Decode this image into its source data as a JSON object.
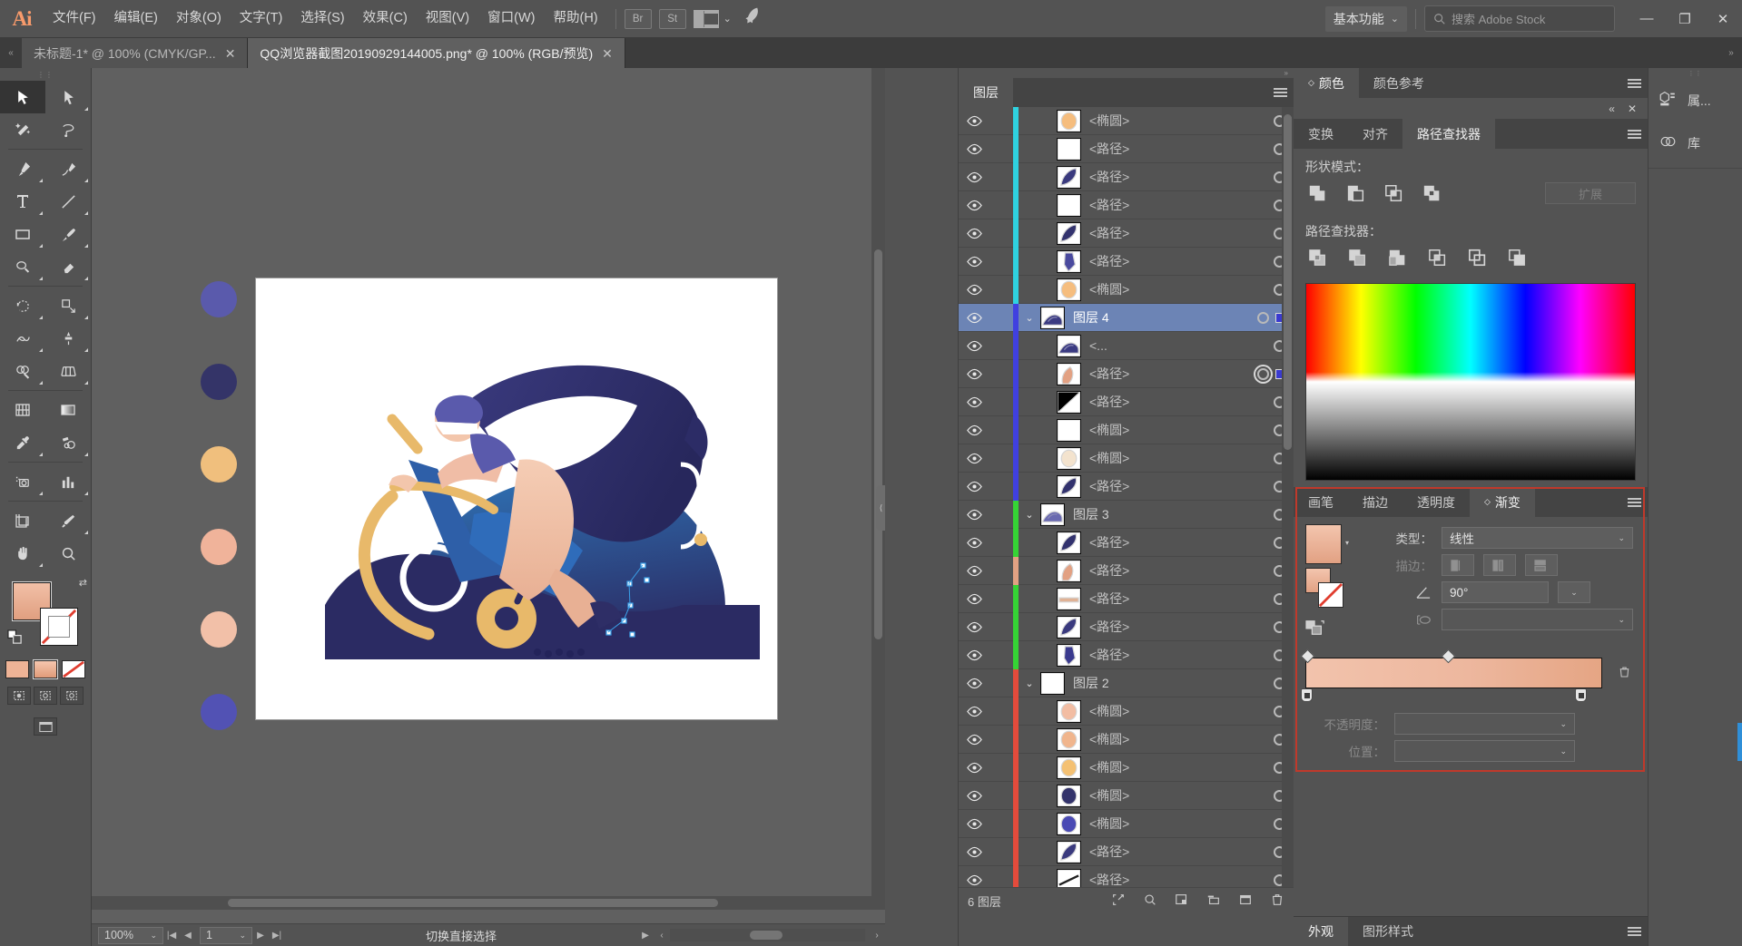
{
  "app": {
    "logo": "Ai",
    "title": "Adobe Illustrator"
  },
  "menubar": {
    "items": [
      {
        "label": "文件(F)"
      },
      {
        "label": "编辑(E)"
      },
      {
        "label": "对象(O)"
      },
      {
        "label": "文字(T)"
      },
      {
        "label": "选择(S)"
      },
      {
        "label": "效果(C)"
      },
      {
        "label": "视图(V)"
      },
      {
        "label": "窗口(W)"
      },
      {
        "label": "帮助(H)"
      }
    ],
    "bridge_label": "Br",
    "stock_label": "St",
    "arrange_icon": "arrange-documents-icon",
    "rocket_icon": "rocket-icon",
    "workspace": "基本功能",
    "workspace_chevron": "⌄",
    "search_placeholder": "搜索 Adobe Stock",
    "search_icon": "search-icon",
    "window_buttons": [
      {
        "name": "minimize-button",
        "glyph": "—"
      },
      {
        "name": "restore-button",
        "glyph": "❐"
      },
      {
        "name": "close-button",
        "glyph": "✕"
      }
    ]
  },
  "tabs": {
    "collapse_icon": "chevrons-left-icon",
    "items": [
      {
        "label": "未标题-1* @ 100% (CMYK/GP...",
        "active": false,
        "close": "✕"
      },
      {
        "label": "QQ浏览器截图20190929144005.png* @ 100% (RGB/预览)",
        "active": true,
        "close": "✕"
      }
    ],
    "expand_icon": "chevrons-right-icon"
  },
  "toolbar": {
    "grip": "⋮⋮",
    "tools": [
      {
        "name": "selection-tool",
        "selected": true,
        "corner": false
      },
      {
        "name": "direct-selection-tool",
        "selected": false,
        "corner": true
      },
      {
        "name": "magic-wand-tool",
        "selected": false,
        "corner": false
      },
      {
        "name": "lasso-tool",
        "selected": false,
        "corner": false
      },
      {
        "name": "pen-tool",
        "selected": false,
        "corner": true
      },
      {
        "name": "curvature-tool",
        "selected": false,
        "corner": true
      },
      {
        "name": "type-tool",
        "selected": false,
        "corner": true
      },
      {
        "name": "line-segment-tool",
        "selected": false,
        "corner": true
      },
      {
        "name": "rectangle-tool",
        "selected": false,
        "corner": true
      },
      {
        "name": "paintbrush-tool",
        "selected": false,
        "corner": true
      },
      {
        "name": "shaper-tool",
        "selected": false,
        "corner": true
      },
      {
        "name": "eraser-tool",
        "selected": false,
        "corner": true
      },
      {
        "name": "rotate-tool",
        "selected": false,
        "corner": true
      },
      {
        "name": "scale-tool",
        "selected": false,
        "corner": true
      },
      {
        "name": "width-tool",
        "selected": false,
        "corner": true
      },
      {
        "name": "free-transform-tool",
        "selected": false,
        "corner": true
      },
      {
        "name": "shape-builder-tool",
        "selected": false,
        "corner": true
      },
      {
        "name": "perspective-grid-tool",
        "selected": false,
        "corner": true
      },
      {
        "name": "mesh-tool",
        "selected": false,
        "corner": false
      },
      {
        "name": "gradient-tool",
        "selected": false,
        "corner": false
      },
      {
        "name": "eyedropper-tool",
        "selected": false,
        "corner": true
      },
      {
        "name": "blend-tool",
        "selected": false,
        "corner": true
      },
      {
        "name": "symbol-sprayer-tool",
        "selected": false,
        "corner": true
      },
      {
        "name": "column-graph-tool",
        "selected": false,
        "corner": true
      },
      {
        "name": "artboard-tool",
        "selected": false,
        "corner": false
      },
      {
        "name": "slice-tool",
        "selected": false,
        "corner": true
      },
      {
        "name": "hand-tool",
        "selected": false,
        "corner": true
      },
      {
        "name": "zoom-tool",
        "selected": false,
        "corner": false
      }
    ],
    "fill_color": "#eeb396",
    "stroke_color": "#ffffff",
    "swap_icon": "swap-fill-stroke-icon",
    "default_icon": "default-fill-stroke-icon",
    "paint_modes": [
      {
        "name": "color-mode",
        "selected": false,
        "color": "#eeb396"
      },
      {
        "name": "gradient-mode",
        "selected": true,
        "color": "#eeb396"
      },
      {
        "name": "none-mode",
        "selected": false,
        "color": "none"
      }
    ],
    "screen_modes": [
      {
        "name": "normal-screen-mode",
        "selected": false
      },
      {
        "name": "full-screen-menubar-mode",
        "selected": false
      },
      {
        "name": "full-screen-mode",
        "selected": false
      }
    ],
    "draw_modes": [
      {
        "name": "draw-normal",
        "selected": true
      },
      {
        "name": "draw-behind",
        "selected": false
      }
    ]
  },
  "canvas": {
    "artboard_background": "#ffffff",
    "swatch_circles": [
      {
        "color": "#5a5aac"
      },
      {
        "color": "#343468"
      },
      {
        "color": "#f0bf7d"
      },
      {
        "color": "#f0b39a"
      },
      {
        "color": "#f0bda6"
      },
      {
        "color": "#5252b4"
      }
    ],
    "illustration_name": "cyclist-on-stationary-bike-illustration",
    "collapse_grip": "⟨"
  },
  "statusbar": {
    "zoom_level": "100%",
    "zoom_dropdown": "⌄",
    "nav_first": "|◀",
    "nav_prev": "◀",
    "page": "1",
    "page_dropdown": "⌄",
    "nav_next": "▶",
    "nav_last": "▶|",
    "status_text": "切换直接选择",
    "status_arrow": "▶",
    "scroll_left": "‹",
    "scroll_right": "›"
  },
  "layers_panel": {
    "tab_label": "图层",
    "menu_icon": "panel-menu-icon",
    "rows": [
      {
        "name": "<椭圆>",
        "type": "child",
        "color": "#2fd2e0",
        "thumb": "#f5bd7e",
        "thumb_kind": "ellipse",
        "eye": true,
        "selected": false,
        "target_double": false,
        "has_sel_square": false
      },
      {
        "name": "<路径>",
        "type": "child",
        "color": "#2fd2e0",
        "thumb": "#ffffff",
        "thumb_kind": "blank",
        "eye": true,
        "selected": false,
        "target_double": false,
        "has_sel_square": false
      },
      {
        "name": "<路径>",
        "type": "child",
        "color": "#2fd2e0",
        "thumb": "#3a3a7e",
        "thumb_kind": "leaf",
        "eye": true,
        "selected": false,
        "target_double": false,
        "has_sel_square": false
      },
      {
        "name": "<路径>",
        "type": "child",
        "color": "#2fd2e0",
        "thumb": "#ffffff",
        "thumb_kind": "blank",
        "eye": true,
        "selected": false,
        "target_double": false,
        "has_sel_square": false
      },
      {
        "name": "<路径>",
        "type": "child",
        "color": "#2fd2e0",
        "thumb": "#33336e",
        "thumb_kind": "leaf",
        "eye": true,
        "selected": false,
        "target_double": false,
        "has_sel_square": false
      },
      {
        "name": "<路径>",
        "type": "child",
        "color": "#2fd2e0",
        "thumb": "#4a4a9e",
        "thumb_kind": "shape",
        "eye": true,
        "selected": false,
        "target_double": false,
        "has_sel_square": false
      },
      {
        "name": "<椭圆>",
        "type": "child",
        "color": "#2fd2e0",
        "thumb": "#f5bd7e",
        "thumb_kind": "ellipse",
        "eye": true,
        "selected": false,
        "target_double": false,
        "has_sel_square": false
      },
      {
        "name": "图层 4",
        "type": "group",
        "color": "#4040e0",
        "thumb": "#3b3b82",
        "thumb_kind": "scene",
        "eye": true,
        "selected": true,
        "target_double": false,
        "has_sel_square": true
      },
      {
        "name": "<...",
        "type": "child",
        "color": "#4040e0",
        "thumb": "#3b3b82",
        "thumb_kind": "scene",
        "eye": true,
        "selected": false,
        "target_double": false,
        "has_sel_square": false
      },
      {
        "name": "<路径>",
        "type": "child",
        "color": "#4040e0",
        "thumb": "#e2a183",
        "thumb_kind": "skin",
        "eye": true,
        "selected": false,
        "target_double": true,
        "has_sel_square": true
      },
      {
        "name": "<路径>",
        "type": "child",
        "color": "#4040e0",
        "thumb": "#000000",
        "thumb_kind": "triangle",
        "eye": true,
        "selected": false,
        "target_double": false,
        "has_sel_square": false
      },
      {
        "name": "<椭圆>",
        "type": "child",
        "color": "#4040e0",
        "thumb": "#ffffff",
        "thumb_kind": "blank",
        "eye": true,
        "selected": false,
        "target_double": false,
        "has_sel_square": false
      },
      {
        "name": "<椭圆>",
        "type": "child",
        "color": "#4040e0",
        "thumb": "#f3e3ce",
        "thumb_kind": "ellipse",
        "eye": true,
        "selected": false,
        "target_double": false,
        "has_sel_square": false
      },
      {
        "name": "<路径>",
        "type": "child",
        "color": "#4040e0",
        "thumb": "#32326e",
        "thumb_kind": "leaf",
        "eye": true,
        "selected": false,
        "target_double": false,
        "has_sel_square": false
      },
      {
        "name": "图层 3",
        "type": "group",
        "color": "#35d435",
        "thumb": "#6a6ab0",
        "thumb_kind": "scene",
        "eye": true,
        "selected": false,
        "target_double": false,
        "has_sel_square": false
      },
      {
        "name": "<路径>",
        "type": "child",
        "color": "#35d435",
        "thumb": "#32326e",
        "thumb_kind": "leaf",
        "eye": true,
        "selected": false,
        "target_double": false,
        "has_sel_square": false
      },
      {
        "name": "<路径>",
        "type": "child",
        "color": "#e2a183",
        "thumb": "#e2a183",
        "thumb_kind": "skin",
        "eye": true,
        "selected": false,
        "target_double": false,
        "has_sel_square": false
      },
      {
        "name": "<路径>",
        "type": "child",
        "color": "#35d435",
        "thumb": "#e0b295",
        "thumb_kind": "bar",
        "eye": true,
        "selected": false,
        "target_double": false,
        "has_sel_square": false
      },
      {
        "name": "<路径>",
        "type": "child",
        "color": "#35d435",
        "thumb": "#3a3a7e",
        "thumb_kind": "leaf",
        "eye": true,
        "selected": false,
        "target_double": false,
        "has_sel_square": false
      },
      {
        "name": "<路径>",
        "type": "child",
        "color": "#35d435",
        "thumb": "#3a3a8e",
        "thumb_kind": "shape",
        "eye": true,
        "selected": false,
        "target_double": false,
        "has_sel_square": false
      },
      {
        "name": "图层 2",
        "type": "group",
        "color": "#e44b3c",
        "thumb": "#ffffff",
        "thumb_kind": "blank",
        "eye": true,
        "selected": false,
        "target_double": false,
        "has_sel_square": false
      },
      {
        "name": "<椭圆>",
        "type": "child",
        "color": "#e44b3c",
        "thumb": "#f2bda3",
        "thumb_kind": "ellipse",
        "eye": true,
        "selected": false,
        "target_double": false,
        "has_sel_square": false
      },
      {
        "name": "<椭圆>",
        "type": "child",
        "color": "#e44b3c",
        "thumb": "#f0b58d",
        "thumb_kind": "ellipse",
        "eye": true,
        "selected": false,
        "target_double": false,
        "has_sel_square": false
      },
      {
        "name": "<椭圆>",
        "type": "child",
        "color": "#e44b3c",
        "thumb": "#f4c173",
        "thumb_kind": "ellipse",
        "eye": true,
        "selected": false,
        "target_double": false,
        "has_sel_square": false
      },
      {
        "name": "<椭圆>",
        "type": "child",
        "color": "#e44b3c",
        "thumb": "#33336b",
        "thumb_kind": "ellipse",
        "eye": true,
        "selected": false,
        "target_double": false,
        "has_sel_square": false
      },
      {
        "name": "<椭圆>",
        "type": "child",
        "color": "#e44b3c",
        "thumb": "#4a4ab4",
        "thumb_kind": "ellipse",
        "eye": true,
        "selected": false,
        "target_double": false,
        "has_sel_square": false
      },
      {
        "name": "<路径>",
        "type": "child",
        "color": "#e44b3c",
        "thumb": "#3a3a7e",
        "thumb_kind": "leaf",
        "eye": true,
        "selected": false,
        "target_double": false,
        "has_sel_square": false
      },
      {
        "name": "<路径>",
        "type": "child",
        "color": "#e44b3c",
        "thumb": "#202020",
        "thumb_kind": "line",
        "eye": true,
        "selected": false,
        "target_double": false,
        "has_sel_square": false
      }
    ],
    "footer": {
      "count_text": "6 图层",
      "icons": [
        {
          "name": "locate-object-icon",
          "glyph": "⇱"
        },
        {
          "name": "search-layers-icon",
          "glyph": "⌕"
        },
        {
          "name": "make-clipping-mask-icon",
          "glyph": "▣"
        },
        {
          "name": "create-new-sublayer-icon",
          "glyph": "⧉"
        },
        {
          "name": "create-new-layer-icon",
          "glyph": "▤"
        },
        {
          "name": "delete-selection-icon",
          "glyph": "🗑"
        }
      ]
    }
  },
  "color_panel": {
    "tabs": [
      {
        "label": "颜色",
        "active": true,
        "has_diamond": true
      },
      {
        "label": "颜色参考",
        "active": false,
        "has_diamond": false
      }
    ],
    "menu_icon": "panel-menu-icon"
  },
  "pathfinder_panel": {
    "collapse_icon": "«",
    "close_icon": "✕",
    "tabs": [
      {
        "label": "变换",
        "active": false
      },
      {
        "label": "对齐",
        "active": false
      },
      {
        "label": "路径查找器",
        "active": true
      }
    ],
    "menu_icon": "panel-menu-icon",
    "shape_modes_label": "形状模式：",
    "shape_modes": [
      {
        "name": "unite-button"
      },
      {
        "name": "minus-front-button"
      },
      {
        "name": "intersect-button"
      },
      {
        "name": "exclude-button"
      }
    ],
    "expand_label": "扩展",
    "pathfinders_label": "路径查找器：",
    "pathfinders": [
      {
        "name": "divide-button"
      },
      {
        "name": "trim-button"
      },
      {
        "name": "merge-button"
      },
      {
        "name": "crop-button"
      },
      {
        "name": "outline-button"
      },
      {
        "name": "minus-back-button"
      }
    ]
  },
  "gradient_panel": {
    "tabs": [
      {
        "label": "画笔",
        "active": false,
        "has_diamond": false
      },
      {
        "label": "描边",
        "active": false,
        "has_diamond": false
      },
      {
        "label": "透明度",
        "active": false,
        "has_diamond": false
      },
      {
        "label": "渐变",
        "active": true,
        "has_diamond": true
      }
    ],
    "menu_icon": "panel-menu-icon",
    "type_label": "类型：",
    "type_value": "线性",
    "stroke_label": "描边：",
    "stroke_options": [
      {
        "name": "stroke-within-button"
      },
      {
        "name": "stroke-along-button"
      },
      {
        "name": "stroke-across-button"
      }
    ],
    "angle_icon": "angle-icon",
    "angle_value": "90°",
    "aspect_icon": "aspect-ratio-icon",
    "aspect_value": "",
    "gradient_preview_from": "#f2c3ac",
    "gradient_preview_to": "#e5a584",
    "stops": [
      {
        "position": 0,
        "color": "#f2c3ac"
      },
      {
        "position": 100,
        "color": "#e5a584"
      }
    ],
    "midpoint": 50,
    "delete_stop_icon": "trash-icon",
    "opacity_label": "不透明度：",
    "opacity_value": "",
    "location_label": "位置：",
    "location_value": ""
  },
  "appearance_panel": {
    "tabs": [
      {
        "label": "外观",
        "active": true
      },
      {
        "label": "图形样式",
        "active": false
      }
    ],
    "menu_icon": "panel-menu-icon"
  },
  "dock": {
    "grip": "⋮⋮",
    "items": [
      {
        "label": "属...",
        "icon": "properties-icon"
      },
      {
        "label": "库",
        "icon": "libraries-icon"
      }
    ]
  }
}
